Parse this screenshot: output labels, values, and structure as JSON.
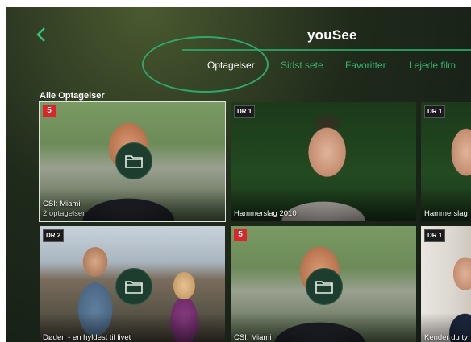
{
  "header": {
    "brand": "youSee",
    "back_icon": "chevron-left-icon"
  },
  "tabs": [
    {
      "label": "Optagelser",
      "active": true
    },
    {
      "label": "Sidst sete",
      "active": false
    },
    {
      "label": "Favoritter",
      "active": false
    },
    {
      "label": "Lejede film",
      "active": false
    }
  ],
  "section_title": "Alle Optagelser",
  "tiles": [
    {
      "channel": "5",
      "title": "CSI: Miami",
      "subtitle": "2 optagelser",
      "folder": true
    },
    {
      "channel": "DR 1",
      "title": "Hammerslag 2010",
      "subtitle": "",
      "folder": false
    },
    {
      "channel": "DR 1",
      "title": "Hammerslag",
      "subtitle": "",
      "folder": false
    },
    {
      "channel": "DR 2",
      "title": "Døden - en hyldest til livet",
      "subtitle": "",
      "folder": true
    },
    {
      "channel": "5",
      "title": "CSI: Miami",
      "subtitle": "",
      "folder": true
    },
    {
      "channel": "DR 1",
      "title": "Kender du ty",
      "subtitle": "",
      "folder": false
    }
  ],
  "colors": {
    "accent": "#2ea86a",
    "tab_inactive": "#36b56f",
    "badge_red": "#d8262b"
  }
}
